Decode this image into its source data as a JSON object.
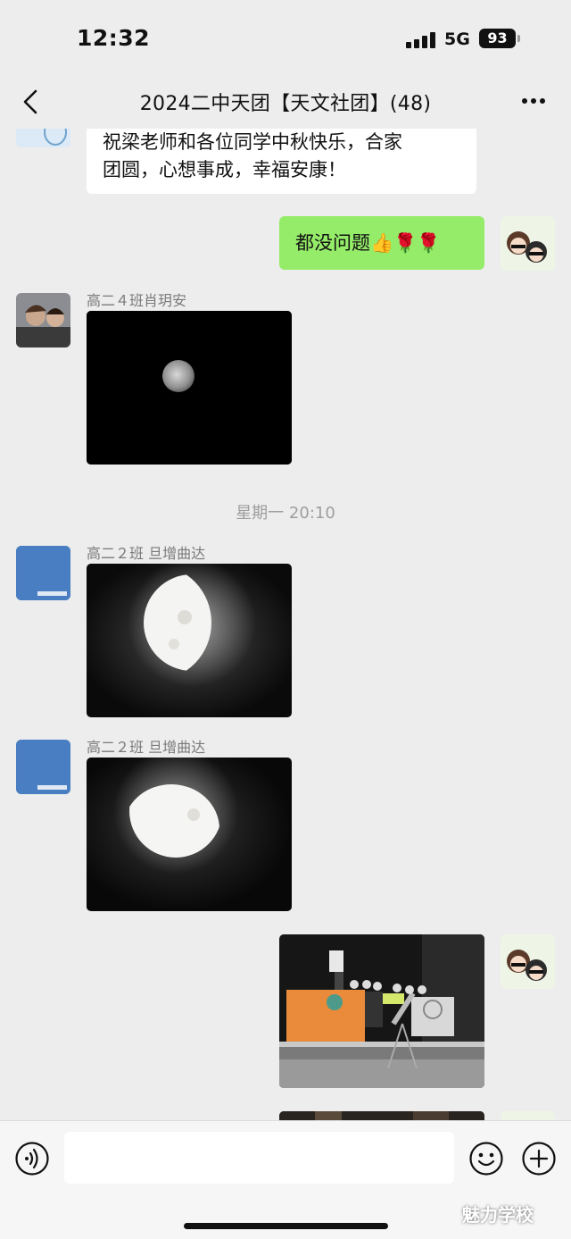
{
  "status_bar": {
    "time": "12:32",
    "network": "5G",
    "battery": "93"
  },
  "nav": {
    "title": "2024二中天团【天文社团】(48)"
  },
  "messages": {
    "m1": {
      "text_line1": "祝梁老师和各位同学中秋快乐，合家",
      "text_line2": "团圆，心想事成，幸福安康！"
    },
    "m2": {
      "text": "都没问题👍🌹🌹"
    },
    "m3": {
      "sender": "高二４班肖玥安"
    },
    "timestamp": "星期一 20:10",
    "m4": {
      "sender": "高二２班 旦增曲达"
    },
    "m5": {
      "sender": "高二２班 旦增曲达"
    }
  },
  "input": {
    "placeholder": ""
  },
  "watermark": "魅力学校"
}
